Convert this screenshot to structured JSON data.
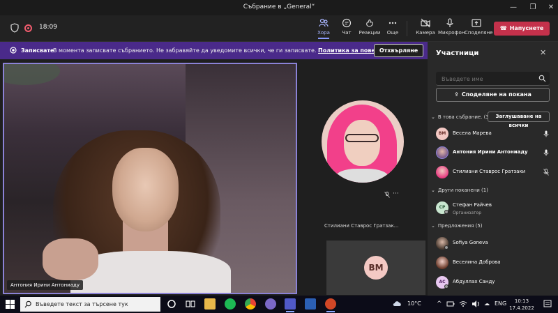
{
  "window": {
    "title": "Събрание в „General“",
    "minimize": "—",
    "maximize": "❐",
    "close": "✕"
  },
  "toolbar": {
    "timer": "18:09",
    "buttons": [
      {
        "label": "Хора",
        "icon": "people-icon"
      },
      {
        "label": "Чат",
        "icon": "chat-icon"
      },
      {
        "label": "Реакции",
        "icon": "reactions-icon"
      },
      {
        "label": "Още",
        "icon": "more-icon"
      },
      {
        "label": "Камера",
        "icon": "camera-off-icon"
      },
      {
        "label": "Микрофон",
        "icon": "microphone-icon"
      },
      {
        "label": "Споделяне",
        "icon": "share-icon"
      }
    ],
    "leave_label": "Напуснете"
  },
  "banner": {
    "title": "Записвате",
    "text": "В момента записвате събранието. Не забравяйте да уведомите всички, че ги записвате.",
    "link": "Политика за поверителност",
    "dismiss": "Отхвърляне"
  },
  "stage": {
    "main_name": "Антония Ирини Антониаду",
    "tile_name": "Стилиани Ставрос Гратзак...",
    "tile_more": "···",
    "vm_initials": "ВМ"
  },
  "panel": {
    "title": "Участници",
    "close": "✕",
    "search_placeholder": "Въведете име",
    "share_invite": "Споделяне на покана",
    "in_meeting_label": "В това събрание. (3)",
    "mute_all": "Заглушаване на всички",
    "in_meeting": [
      {
        "name": "Весела Марева",
        "initials": "ВМ"
      },
      {
        "name": "Антония Ирини Антониаду",
        "initials": ""
      },
      {
        "name": "Стилиани Ставрос Гратзаки",
        "initials": ""
      }
    ],
    "others_label": "Други поканени (1)",
    "others": [
      {
        "name": "Стефан Райчев",
        "role": "Организатор",
        "initials": "СР"
      }
    ],
    "suggestions_label": "Предложения (5)",
    "suggestions": [
      {
        "name": "Sofiya Goneva",
        "initials": ""
      },
      {
        "name": "Веселина Доброва",
        "initials": ""
      },
      {
        "name": "Абдуллах Санду",
        "initials": "АС"
      }
    ]
  },
  "taskbar": {
    "search_text": "Въведете текст за търсене тук",
    "weather": "10°C",
    "language": "ENG",
    "time": "10:13",
    "date": "17.4.2022 г."
  },
  "colors": {
    "banner": "#4a2a8a",
    "leave": "#c4314b",
    "accent": "#8b82d6"
  }
}
